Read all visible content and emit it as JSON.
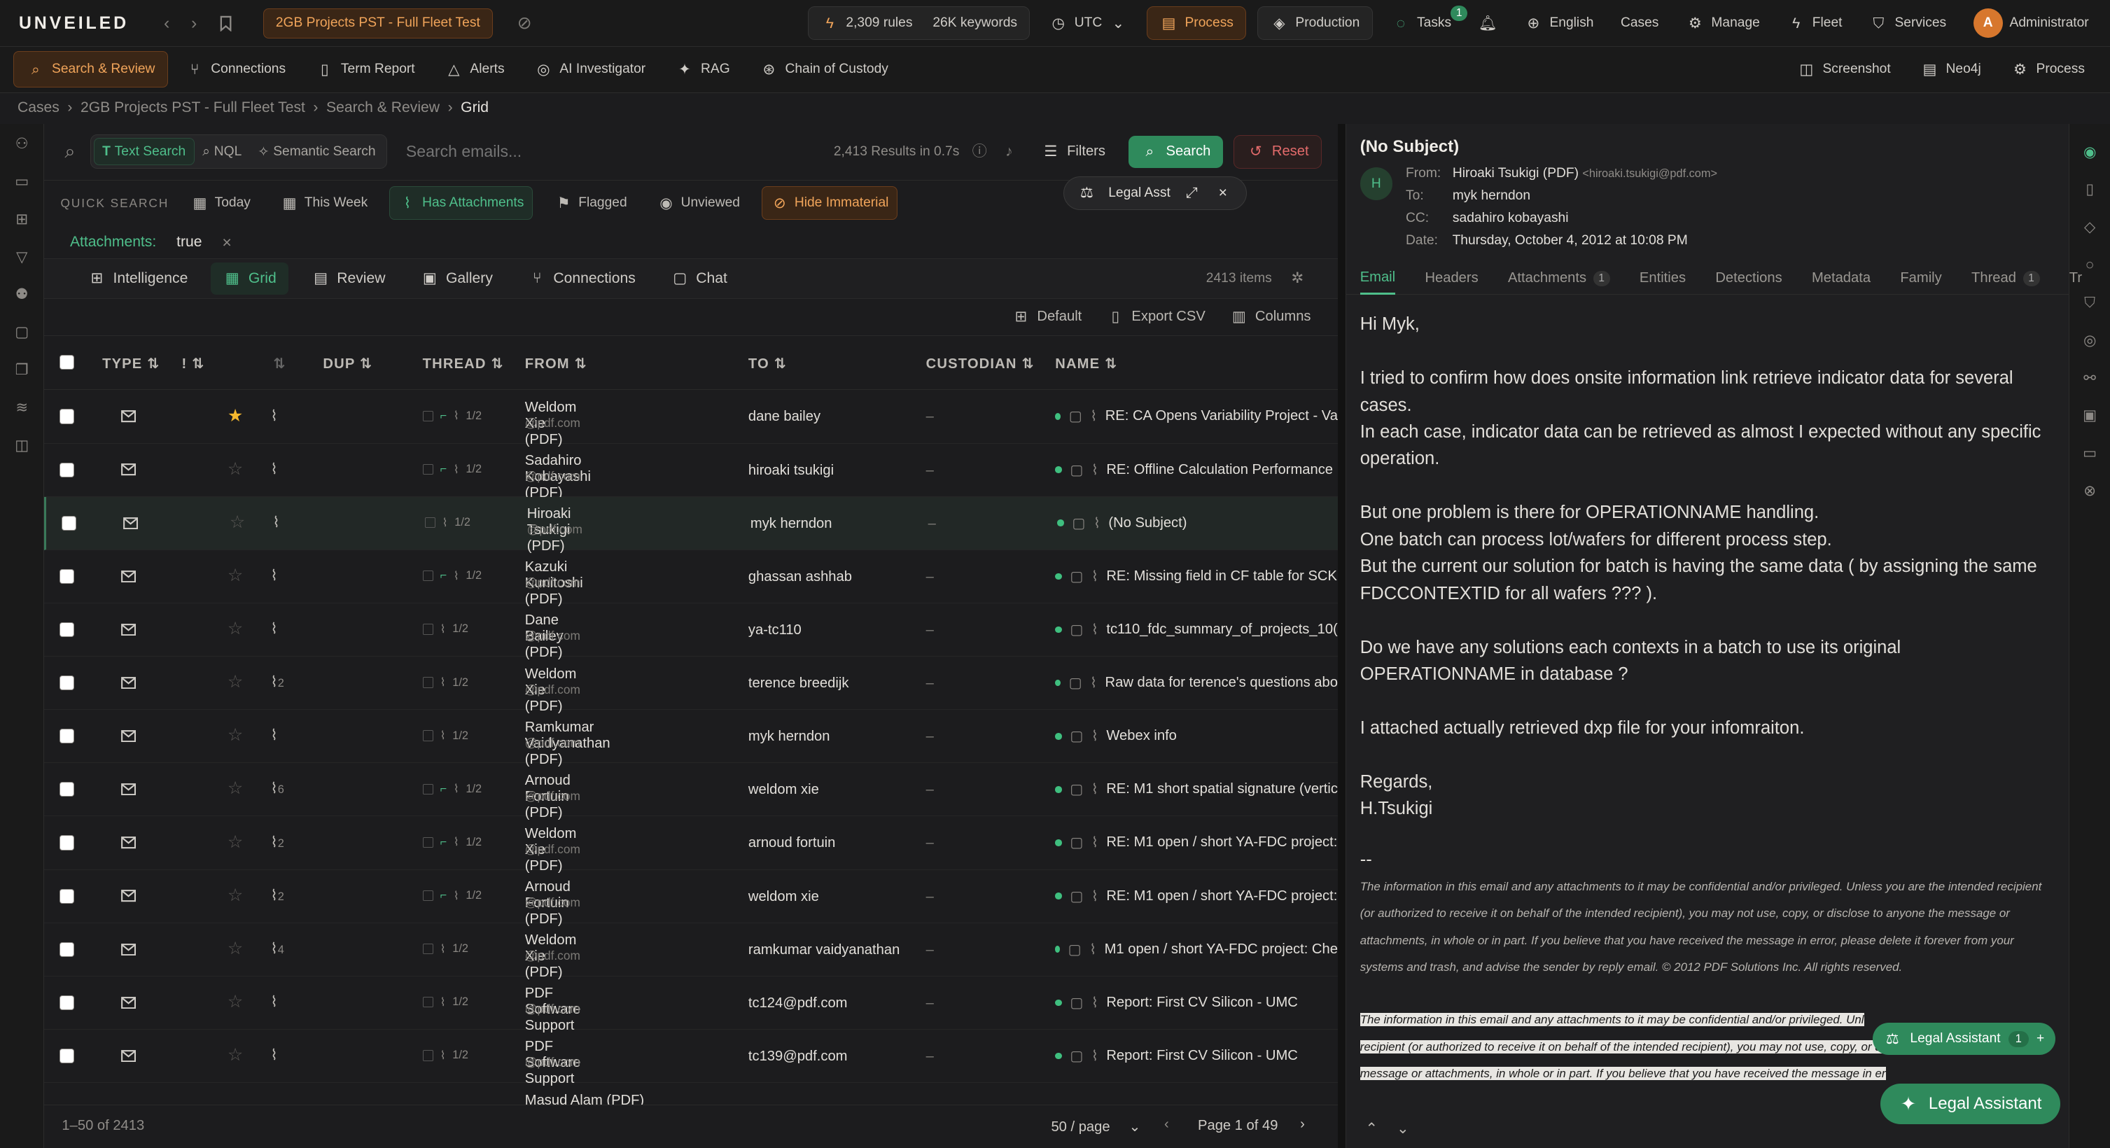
{
  "app": {
    "logo": "UNVEILED",
    "case": "2GB Projects PST - Full Fleet Test",
    "rules": "2,309 rules",
    "keywords": "26K keywords",
    "tz": "UTC",
    "process": "Process",
    "production": "Production",
    "tasks": "Tasks",
    "tasks_badge": "1",
    "language": "English",
    "cases": "Cases",
    "manage": "Manage",
    "fleet": "Fleet",
    "services": "Services",
    "user_initial": "A",
    "user": "Administrator"
  },
  "nav2": {
    "items": [
      "Search & Review",
      "Connections",
      "Term Report",
      "Alerts",
      "AI Investigator",
      "RAG",
      "Chain of Custody"
    ],
    "right": [
      "Screenshot",
      "Neo4j",
      "Process"
    ]
  },
  "breadcrumb": [
    "Cases",
    "2GB Projects PST - Full Fleet Test",
    "Search & Review",
    "Grid"
  ],
  "search": {
    "modes": [
      "Text Search",
      "NQL",
      "Semantic Search"
    ],
    "placeholder": "Search emails...",
    "results": "2,413 Results in 0.7s",
    "filters": "Filters",
    "search": "Search",
    "reset": "Reset"
  },
  "quick": {
    "label": "QUICK SEARCH",
    "items": [
      "Today",
      "This Week",
      "Has Attachments",
      "Flagged",
      "Unviewed",
      "Hide Immaterial"
    ]
  },
  "chip": {
    "key": "Attachments:",
    "value": "true"
  },
  "legal_float": "Legal Asst",
  "views": {
    "items": [
      "Intelligence",
      "Grid",
      "Review",
      "Gallery",
      "Connections",
      "Chat"
    ],
    "count": "2413 items"
  },
  "actions": [
    "Default",
    "Export CSV",
    "Columns"
  ],
  "columns": {
    "type": "TYPE",
    "flag": "!",
    "dup": "DUP",
    "thread": "THREAD",
    "from": "FROM",
    "to": "TO",
    "custodian": "CUSTODIAN",
    "name": "NAME"
  },
  "rows": [
    {
      "starred": true,
      "att": "",
      "thread": "1/2",
      "branch": true,
      "from": "Weldom Xie (PDF)",
      "domain": "@pdf.com",
      "to": "dane bailey",
      "cust": "–",
      "name": "RE: CA Opens Variability Project - Va"
    },
    {
      "starred": false,
      "att": "",
      "thread": "1/2",
      "branch": true,
      "from": "Sadahiro Kobayashi (PDF)",
      "domain": "@pdf.com",
      "to": "hiroaki tsukigi",
      "cust": "–",
      "name": "RE: Offline Calculation Performance"
    },
    {
      "starred": false,
      "att": "",
      "thread": "1/2",
      "branch": false,
      "from": "Hiroaki Tsukigi (PDF)",
      "domain": "@pdf.com",
      "to": "myk herndon",
      "cust": "–",
      "name": "(No Subject)"
    },
    {
      "starred": false,
      "att": "",
      "thread": "1/2",
      "branch": true,
      "from": "Kazuki Kunitoshi (PDF)",
      "domain": "@pdf.com",
      "to": "ghassan ashhab",
      "cust": "–",
      "name": "RE: Missing field in CF table for SCK"
    },
    {
      "starred": false,
      "att": "",
      "thread": "1/2",
      "branch": false,
      "from": "Dane Bailey (PDF)",
      "domain": "@pdf.com",
      "to": "ya-tc110",
      "cust": "–",
      "name": "tc110_fdc_summary_of_projects_10("
    },
    {
      "starred": false,
      "att": "2",
      "thread": "1/2",
      "branch": false,
      "from": "Weldom Xie (PDF)",
      "domain": "@pdf.com",
      "to": "terence breedijk",
      "cust": "–",
      "name": "Raw data for terence's questions abo"
    },
    {
      "starred": false,
      "att": "",
      "thread": "1/2",
      "branch": false,
      "from": "Ramkumar Vaidyanathan (PDF)",
      "domain": "@pdf.com",
      "to": "myk herndon",
      "cust": "–",
      "name": "Webex info"
    },
    {
      "starred": false,
      "att": "6",
      "thread": "1/2",
      "branch": true,
      "from": "Arnoud Fortuin (PDF)",
      "domain": "@pdf.com",
      "to": "weldom xie",
      "cust": "–",
      "name": "RE: M1 short spatial signature (vertic"
    },
    {
      "starred": false,
      "att": "2",
      "thread": "1/2",
      "branch": true,
      "from": "Weldom Xie (PDF)",
      "domain": "@pdf.com",
      "to": "arnoud fortuin",
      "cust": "–",
      "name": "RE: M1 open / short YA-FDC project:"
    },
    {
      "starred": false,
      "att": "2",
      "thread": "1/2",
      "branch": true,
      "from": "Arnoud Fortuin (PDF)",
      "domain": "@pdf.com",
      "to": "weldom xie",
      "cust": "–",
      "name": "RE: M1 open / short YA-FDC project:"
    },
    {
      "starred": false,
      "att": "4",
      "thread": "1/2",
      "branch": false,
      "from": "Weldom Xie (PDF)",
      "domain": "@pdf.com",
      "to": "ramkumar vaidyanathan",
      "cust": "–",
      "name": "M1 open / short YA-FDC project: Che"
    },
    {
      "starred": false,
      "att": "",
      "thread": "1/2",
      "branch": false,
      "from": "PDF Software Support",
      "domain": "@pdf.com",
      "to": "tc124@pdf.com",
      "cust": "–",
      "name": "Report: First CV Silicon - UMC"
    },
    {
      "starred": false,
      "att": "",
      "thread": "1/2",
      "branch": false,
      "from": "PDF Software Support",
      "domain": "@pdf.com",
      "to": "tc139@pdf.com",
      "cust": "–",
      "name": "Report: First CV Silicon - UMC"
    }
  ],
  "partial_row_from": "Masud Alam (PDF)",
  "pager": {
    "range": "1–50 of 2413",
    "per_page": "50 / page",
    "page": "Page 1 of 49"
  },
  "email": {
    "subject": "(No Subject)",
    "avatar": "H",
    "from_label": "From:",
    "from": "Hiroaki Tsukigi (PDF)",
    "from_email": "<hiroaki.tsukigi@pdf.com>",
    "to_label": "To:",
    "to": "myk herndon",
    "cc_label": "CC:",
    "cc": "sadahiro kobayashi",
    "date_label": "Date:",
    "date": "Thursday, October 4, 2012 at 10:08 PM",
    "tabs": [
      "Email",
      "Headers",
      "Attachments",
      "Entities",
      "Detections",
      "Metadata",
      "Family",
      "Thread",
      "Tr"
    ],
    "attachments_count": "1",
    "thread_count": "1",
    "greeting": "Hi Myk,",
    "p1a": "I tried to confirm how does onsite information link retrieve indicator data for several cases.",
    "p1b": "In each case, indicator data can be retrieved as almost I expected without any specific operation.",
    "p2a": "But one problem is there for OPERATIONNAME handling.",
    "p2b": "One batch can process lot/wafers for different process step.",
    "p2c": "But the current our solution for batch is having the same data ( by assigning the same FDCCONTEXTID for all wafers ??? ).",
    "p3": "Do we have any solutions each contexts in a batch to use its original OPERATIONNAME in database ?",
    "p4": "I attached actually retrieved dxp file for your infomraiton.",
    "reg": "Regards,",
    "sig": "H.Tsukigi",
    "dash": "--",
    "disclaimer": "The information in this email and any attachments to it may be confidential and/or privileged. Unless you are the intended recipient (or authorized to receive it on behalf of the intended recipient), you may not use, copy, or disclose to anyone the message or attachments, in whole or in part. If you believe that you have received the message in error, please delete it forever from your systems and trash, and advise the sender by reply email.  © 2012 PDF Solutions Inc.  All rights reserved.",
    "hl1": "The information in this email and any attachments to it may be confidential and/or privileged. Unl",
    "hl2": "recipient (or authorized to receive it on behalf of the intended recipient), you may not use, copy, or disclose to anyone the",
    "hl3": "message or attachments, in whole or in part. If you believe that you have received the message in er"
  },
  "legal_small": {
    "label": "Legal Assistant",
    "count": "1"
  },
  "legal_big": "Legal Assistant"
}
